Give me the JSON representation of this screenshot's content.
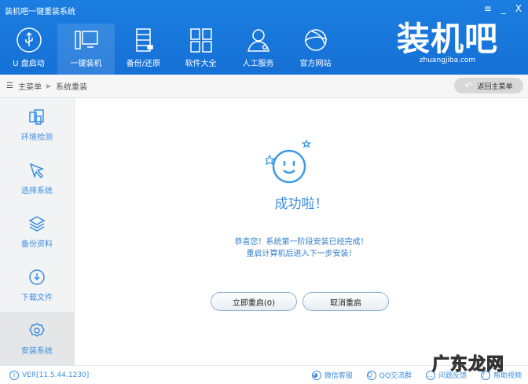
{
  "window": {
    "title": "装机吧一键重装系统",
    "menu": "≡",
    "minimize": "_",
    "close": "X"
  },
  "nav": [
    {
      "label": "U 盘启动",
      "icon": "usb-icon"
    },
    {
      "label": "一键装机",
      "icon": "computer-icon"
    },
    {
      "label": "备份/还原",
      "icon": "backup-icon"
    },
    {
      "label": "软件大全",
      "icon": "grid-icon"
    },
    {
      "label": "人工服务",
      "icon": "person-icon"
    },
    {
      "label": "官方网站",
      "icon": "globe-icon"
    }
  ],
  "logo": {
    "name": "装机吧",
    "url": "zhuangjiba.com"
  },
  "breadcrumb": {
    "home": "主菜单",
    "current": "系统重装",
    "back": "返回主菜单"
  },
  "sidebar": [
    {
      "label": "环境检测"
    },
    {
      "label": "选择系统"
    },
    {
      "label": "备份资料"
    },
    {
      "label": "下载文件"
    },
    {
      "label": "安装系统"
    }
  ],
  "main": {
    "title": "成功啦！",
    "line1": "恭喜您！系统第一阶段安装已经完成！",
    "line2": "重启计算机后进入下一步安装！",
    "restart": "立即重启(0)",
    "cancel": "取消重启"
  },
  "footer": {
    "version": "VER[11.5.44.1230]",
    "links": [
      "微信客服",
      "QQ交流群",
      "问题反馈",
      "帮助视频"
    ]
  },
  "watermark": "广东龙网",
  "colors": {
    "brand": "#1a78dc",
    "accent": "#3d8fe0"
  }
}
